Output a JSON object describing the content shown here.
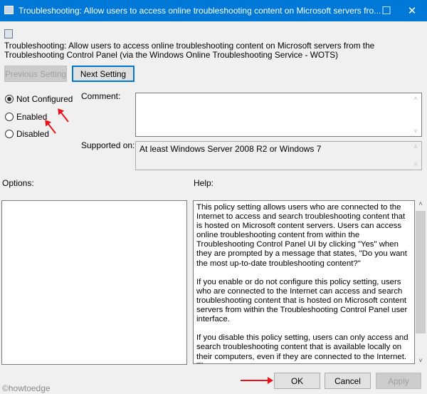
{
  "window": {
    "title": "Troubleshooting: Allow users to access online troubleshooting content on Microsoft servers fro...",
    "maximize_icon": "maximize-icon",
    "close_icon": "close-icon"
  },
  "policy": {
    "name": "Troubleshooting: Allow users to access online troubleshooting content on Microsoft servers from the Troubleshooting Control Panel (via the Windows Online Troubleshooting Service - WOTS)"
  },
  "nav": {
    "previous": "Previous Setting",
    "next": "Next Setting"
  },
  "state": {
    "options": [
      "Not Configured",
      "Enabled",
      "Disabled"
    ],
    "selected": "Not Configured"
  },
  "comment": {
    "label": "Comment:",
    "value": ""
  },
  "supported": {
    "label": "Supported on:",
    "value": "At least Windows Server 2008 R2 or Windows 7"
  },
  "options_label": "Options:",
  "help": {
    "label": "Help:",
    "paragraphs": [
      "This policy setting allows users who are connected to the Internet to access and search troubleshooting content that is hosted on Microsoft content servers. Users can access online troubleshooting content from within the Troubleshooting Control Panel UI by clicking \"Yes\" when they are prompted by a message that states, \"Do you want the most up-to-date troubleshooting content?\"",
      "If you enable or do not configure this policy setting, users who are connected to the Internet can access and search troubleshooting content that is hosted on Microsoft content servers from within the Troubleshooting Control Panel user interface.",
      "If you disable this policy setting, users can only access and search troubleshooting content that is available locally on their computers, even if they are connected to the Internet. They are"
    ]
  },
  "footer": {
    "ok": "OK",
    "cancel": "Cancel",
    "apply": "Apply"
  },
  "watermark": "©howtoedge",
  "colors": {
    "titlebar": "#0078d7",
    "annotation_arrow": "#e8141b"
  }
}
